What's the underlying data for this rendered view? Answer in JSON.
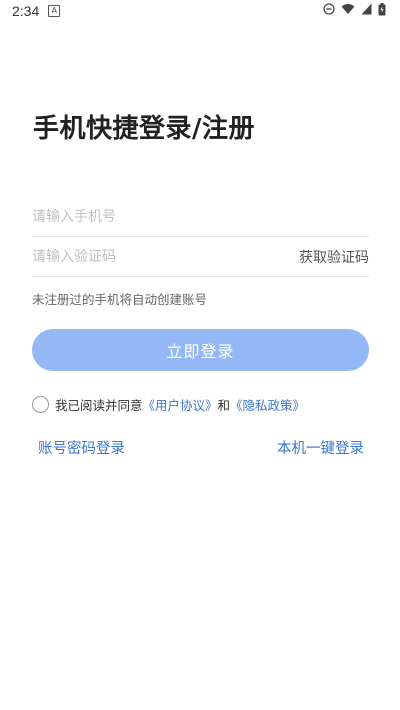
{
  "status_bar": {
    "time": "2:34",
    "notification_icon": "app-notification-icon",
    "icons": [
      "do-not-disturb-icon",
      "wifi-icon",
      "signal-icon",
      "battery-icon"
    ]
  },
  "page": {
    "title": "手机快捷登录/注册"
  },
  "form": {
    "phone_placeholder": "请输入手机号",
    "code_placeholder": "请输入验证码",
    "get_code_label": "获取验证码",
    "hint": "未注册过的手机将自动创建账号",
    "login_button": "立即登录"
  },
  "agreement": {
    "prefix": "我已阅读并同意",
    "user_agreement": "《用户协议》",
    "and": "和",
    "privacy_policy": "《隐私政策》",
    "checked": false
  },
  "alt_login": {
    "password_login": "账号密码登录",
    "one_click_login": "本机一键登录"
  },
  "colors": {
    "primary_button": "#94b8f6",
    "link": "#3a76cf"
  }
}
